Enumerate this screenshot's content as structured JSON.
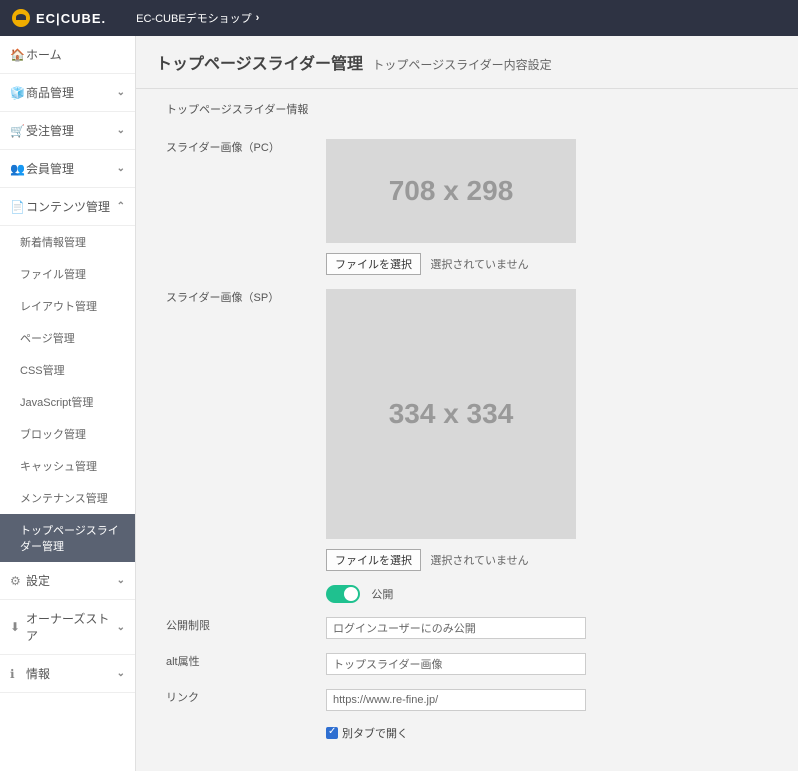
{
  "topbar": {
    "logo_text": "EC|CUBE.",
    "shop_name": "EC-CUBEデモショップ"
  },
  "sidebar": {
    "items": [
      {
        "icon": "🏠",
        "label": "ホーム",
        "caret": ""
      },
      {
        "icon": "🧊",
        "label": "商品管理",
        "caret": "down"
      },
      {
        "icon": "🛒",
        "label": "受注管理",
        "caret": "down"
      },
      {
        "icon": "👥",
        "label": "会員管理",
        "caret": "down"
      },
      {
        "icon": "📄",
        "label": "コンテンツ管理",
        "caret": "up"
      }
    ],
    "content_subitems": [
      "新着情報管理",
      "ファイル管理",
      "レイアウト管理",
      "ページ管理",
      "CSS管理",
      "JavaScript管理",
      "ブロック管理",
      "キャッシュ管理",
      "メンテナンス管理",
      "トップページスライダー管理"
    ],
    "items_after": [
      {
        "icon": "⚙",
        "label": "設定",
        "caret": "down"
      },
      {
        "icon": "⬇",
        "label": "オーナーズストア",
        "caret": "down"
      },
      {
        "icon": "ℹ",
        "label": "情報",
        "caret": "down"
      }
    ]
  },
  "page": {
    "title": "トップページスライダー管理",
    "subtitle": "トップページスライダー内容設定",
    "section_label": "トップページスライダー情報"
  },
  "form": {
    "pc_image_label": "スライダー画像（PC）",
    "pc_placeholder": "708 x 298",
    "sp_image_label": "スライダー画像（SP）",
    "sp_placeholder": "334 x 334",
    "file_select_btn": "ファイルを選択",
    "file_none": "選択されていません",
    "publish_toggle_label": "公開",
    "publish_restrict_label": "公開制限",
    "publish_restrict_value": "ログインユーザーにのみ公開",
    "alt_label": "alt属性",
    "alt_value": "トップスライダー画像",
    "link_label": "リンク",
    "link_value": "https://www.re-fine.jp/",
    "new_tab_label": "別タブで開く"
  }
}
